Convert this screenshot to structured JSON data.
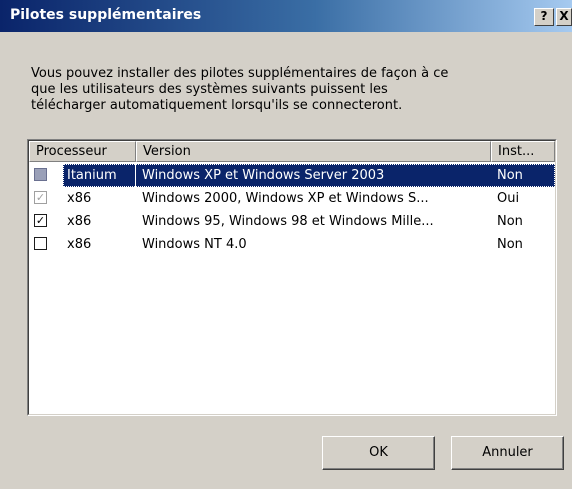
{
  "window": {
    "title": "Pilotes supplémentaires",
    "help_label": "?",
    "close_label": "X"
  },
  "intro": {
    "text": "Vous pouvez installer des pilotes supplémentaires de façon à ce\nque les utilisateurs des systèmes suivants puissent les\ntélécharger automatiquement lorsqu'ils se connecteront."
  },
  "list": {
    "columns": [
      {
        "label": "Processeur"
      },
      {
        "label": "Version"
      },
      {
        "label": "Inst..."
      }
    ],
    "rows": [
      {
        "processor": "Itanium",
        "version": "Windows XP et Windows Server 2003",
        "installed": "Non",
        "check_state": "indeterminate",
        "selected": true
      },
      {
        "processor": "x86",
        "version": "Windows 2000, Windows XP et Windows S...",
        "installed": "Oui",
        "check_state": "checked-disabled",
        "selected": false
      },
      {
        "processor": "x86",
        "version": "Windows 95, Windows 98 et Windows Mille...",
        "installed": "Non",
        "check_state": "checked",
        "selected": false
      },
      {
        "processor": "x86",
        "version": "Windows NT 4.0",
        "installed": "Non",
        "check_state": "unchecked",
        "selected": false
      }
    ]
  },
  "buttons": {
    "ok_label": "OK",
    "cancel_label": "Annuler"
  },
  "colors": {
    "titlebar_start": "#0a246a",
    "titlebar_end": "#a6caf0",
    "selection": "#0a246a",
    "dialog_bg": "#d4d0c8"
  }
}
